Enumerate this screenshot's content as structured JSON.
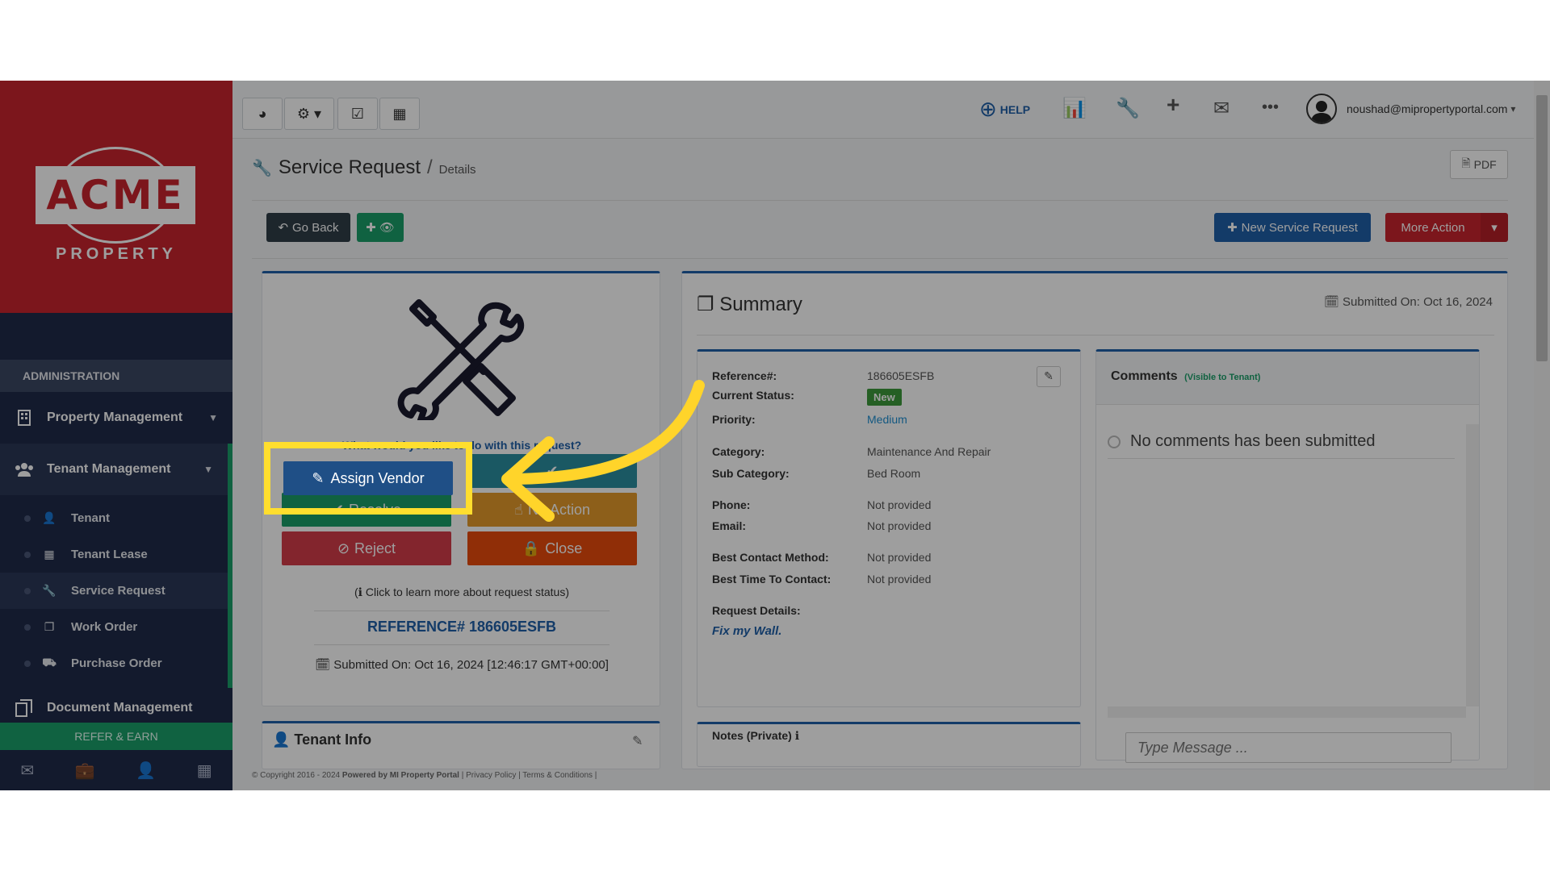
{
  "brand": {
    "logo_text": "ACME",
    "logo_sub": "PROPERTY"
  },
  "sidebar": {
    "section_title": "ADMINISTRATION",
    "items": [
      {
        "label": "Property Management"
      },
      {
        "label": "Tenant Management"
      },
      {
        "label": "Document Management"
      }
    ],
    "submenu": [
      {
        "label": "Tenant",
        "icon": "user-icon"
      },
      {
        "label": "Tenant Lease",
        "icon": "calendar-icon"
      },
      {
        "label": "Service Request",
        "icon": "wrench-icon"
      },
      {
        "label": "Work Order",
        "icon": "copy-icon"
      },
      {
        "label": "Purchase Order",
        "icon": "truck-icon"
      }
    ],
    "refer_label": "REFER & EARN"
  },
  "topbar": {
    "help_label": "HELP",
    "user_email": "noushad@mipropertyportal.com"
  },
  "page": {
    "title": "Service Request",
    "separator": "/",
    "subtitle": "Details",
    "pdf_label": "PDF",
    "go_back_label": "Go Back",
    "new_request_label": "New Service Request",
    "more_action_label": "More Action"
  },
  "actions": {
    "prompt": "What would you like to do with this request?",
    "assign_vendor": "Assign Vendor",
    "resolve": "Resolve",
    "no_action": "No Action",
    "reject": "Reject",
    "close": "Close",
    "learn_more": "Click to learn more about request status)",
    "reference_label": "REFERENCE# 186605ESFB",
    "submitted_on": "Submitted On: Oct 16, 2024 [12:46:17 GMT+00:00]"
  },
  "summary": {
    "title": "Summary",
    "submitted_on": "Submitted On: Oct 16, 2024",
    "rows": [
      {
        "label": "Reference#:",
        "value": "186605ESFB"
      },
      {
        "label": "Current Status:",
        "value": "New"
      },
      {
        "label": "Priority:",
        "value": "Medium"
      },
      {
        "label": "Category:",
        "value": "Maintenance And Repair"
      },
      {
        "label": "Sub Category:",
        "value": "Bed Room"
      },
      {
        "label": "Phone:",
        "value": "Not provided"
      },
      {
        "label": "Email:",
        "value": "Not provided"
      },
      {
        "label": "Best Contact Method:",
        "value": "Not provided"
      },
      {
        "label": "Best Time To Contact:",
        "value": "Not provided"
      },
      {
        "label": "Request Details:",
        "value": ""
      }
    ],
    "request_details": "Fix my Wall.",
    "notes_title": "Notes (Private)"
  },
  "comments": {
    "title": "Comments",
    "visibility": "(Visible to Tenant)",
    "empty": "No comments has been submitted",
    "input_placeholder": "Type Message ..."
  },
  "tenant_info": {
    "title": "Tenant Info"
  },
  "footer": {
    "text": "© Copyright 2016 - 2024",
    "powered": "Powered by MI Property Portal",
    "links": "| Privacy Policy | Terms & Conditions |"
  },
  "colors": {
    "sidebar": "#1f2b4a",
    "brand_red": "#c8252e",
    "primary": "#1f5fa8",
    "success": "#1b9f6a",
    "highlight": "#ffde2e"
  }
}
